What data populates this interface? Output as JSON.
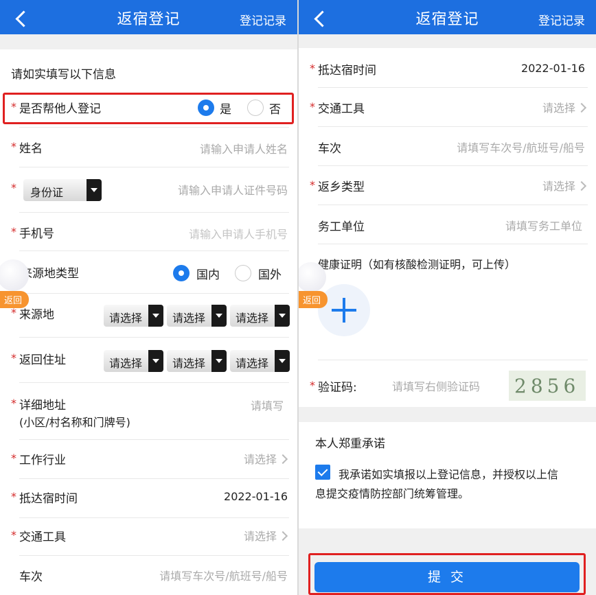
{
  "left": {
    "header": {
      "title": "返宿登记",
      "right_link": "登记记录"
    },
    "intro": "请如实填写以下信息",
    "help_register": {
      "label": "是否帮他人登记",
      "yes": "是",
      "no": "否",
      "selected": "是"
    },
    "name": {
      "label": "姓名",
      "placeholder": "请输入申请人姓名"
    },
    "id_type": {
      "value": "身份证",
      "placeholder": "请输入申请人证件号码"
    },
    "phone": {
      "label": "手机号",
      "placeholder": "请输入申请人手机号"
    },
    "origin_type": {
      "label": "来源地类型",
      "domestic": "国内",
      "foreign": "国外",
      "selected": "国内"
    },
    "origin": {
      "label": "来源地",
      "selects": [
        "请选择",
        "请选择",
        "请选择"
      ]
    },
    "return_address": {
      "label": "返回住址",
      "selects": [
        "请选择",
        "请选择",
        "请选择"
      ]
    },
    "detail_address": {
      "label": "详细地址",
      "sublabel": "(小区/村名称和门牌号)",
      "placeholder": "请填写"
    },
    "industry": {
      "label": "工作行业",
      "placeholder": "请选择"
    },
    "arrival_time": {
      "label": "抵达宿时间",
      "value": "2022-01-16"
    },
    "transport": {
      "label": "交通工具",
      "placeholder": "请选择"
    },
    "train_no": {
      "label": "车次",
      "placeholder": "请填写车次号/航班号/船号"
    },
    "float_button": {
      "label": "返回"
    }
  },
  "right": {
    "header": {
      "title": "返宿登记",
      "right_link": "登记记录"
    },
    "arrival_time": {
      "label": "抵达宿时间",
      "value": "2022-01-16"
    },
    "transport": {
      "label": "交通工具",
      "placeholder": "请选择"
    },
    "train_no": {
      "label": "车次",
      "placeholder": "请填写车次号/航班号/船号"
    },
    "return_type": {
      "label": "返乡类型",
      "placeholder": "请选择"
    },
    "work_unit": {
      "label": "务工单位",
      "placeholder": "请填写务工单位"
    },
    "health_cert": {
      "label": "健康证明（如有核酸检测证明，可上传）"
    },
    "captcha": {
      "label": "验证码:",
      "placeholder": "请填写右侧验证码",
      "image_text": "2856"
    },
    "promise": {
      "title": "本人郑重承诺",
      "line1": "我承诺如实填报以上登记信息，并授权以上信",
      "line2": "息提交疫情防控部门统筹管理。",
      "checked": true
    },
    "submit_label": "提 交",
    "float_button": {
      "label": "返回"
    }
  },
  "colors": {
    "header_blue": "#1d6fe0",
    "required_star": "#d42b2b",
    "highlight_red": "#e02020",
    "accent_blue": "#1d7bec",
    "float_orange": "#f7942f"
  },
  "icons": [
    "back-arrow-icon",
    "chevron-right-icon",
    "dropdown-arrow-icon",
    "plus-icon",
    "check-icon",
    "mascot-icon"
  ]
}
